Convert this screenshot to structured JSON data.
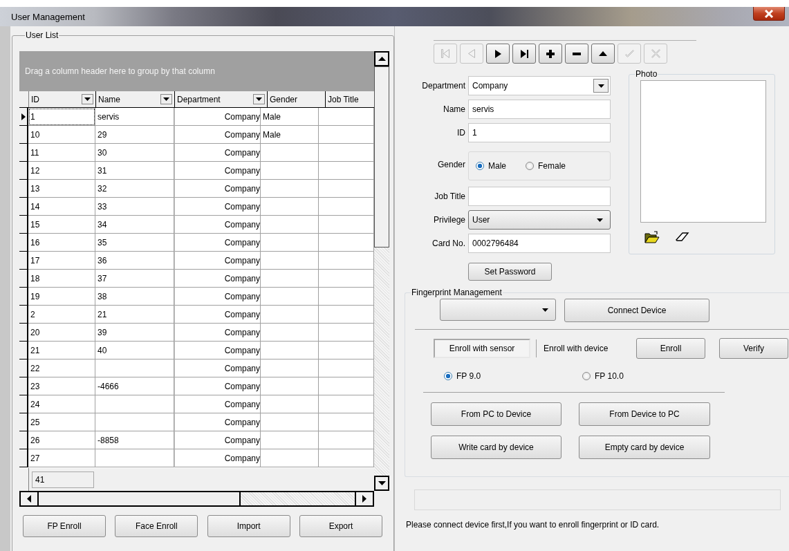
{
  "window": {
    "title": "User Management"
  },
  "user_list": {
    "title": "User List",
    "group_hint": "Drag a column header here to group by that column",
    "columns": [
      {
        "label": "ID",
        "filter": true
      },
      {
        "label": "Name",
        "filter": true
      },
      {
        "label": "Department",
        "filter": true
      },
      {
        "label": "Gender",
        "filter": false
      },
      {
        "label": "Job Title",
        "filter": false
      }
    ],
    "rows": [
      {
        "id": "1",
        "name": "servis",
        "department": "Company",
        "gender": "Male",
        "selected": true
      },
      {
        "id": "10",
        "name": "29",
        "department": "Company",
        "gender": "Male",
        "selected": false
      },
      {
        "id": "11",
        "name": "30",
        "department": "Company",
        "selected": false
      },
      {
        "id": "12",
        "name": "31",
        "department": "Company",
        "selected": false
      },
      {
        "id": "13",
        "name": "32",
        "department": "Company",
        "selected": false
      },
      {
        "id": "14",
        "name": "33",
        "department": "Company",
        "selected": false
      },
      {
        "id": "15",
        "name": "34",
        "department": "Company",
        "selected": false
      },
      {
        "id": "16",
        "name": "35",
        "department": "Company",
        "selected": false
      },
      {
        "id": "17",
        "name": "36",
        "department": "Company",
        "selected": false
      },
      {
        "id": "18",
        "name": "37",
        "department": "Company",
        "selected": false
      },
      {
        "id": "19",
        "name": "38",
        "department": "Company",
        "selected": false
      },
      {
        "id": "2",
        "name": "21",
        "department": "Company",
        "selected": false
      },
      {
        "id": "20",
        "name": "39",
        "department": "Company",
        "selected": false
      },
      {
        "id": "21",
        "name": "40",
        "department": "Company",
        "selected": false
      },
      {
        "id": "22",
        "department": "Company",
        "selected": false
      },
      {
        "id": "23",
        "name": "-4666",
        "department": "Company",
        "selected": false
      },
      {
        "id": "24",
        "department": "Company",
        "selected": false
      },
      {
        "id": "25",
        "department": "Company",
        "selected": false
      },
      {
        "id": "26",
        "name": "-8858",
        "department": "Company",
        "selected": false
      },
      {
        "id": "27",
        "department": "Company",
        "selected": false
      }
    ],
    "footer_count": "41"
  },
  "list_buttons": [
    "FP Enroll",
    "Face Enroll",
    "Import",
    "Export"
  ],
  "navigator": [
    {
      "kind": "first",
      "disabled": true
    },
    {
      "kind": "prev",
      "disabled": true
    },
    {
      "kind": "next",
      "disabled": false
    },
    {
      "kind": "last",
      "disabled": false
    },
    {
      "kind": "add",
      "disabled": false
    },
    {
      "kind": "delete",
      "disabled": false
    },
    {
      "kind": "up",
      "disabled": false
    },
    {
      "kind": "post",
      "disabled": true
    },
    {
      "kind": "cancel",
      "disabled": true
    }
  ],
  "form": {
    "department": {
      "label": "Department",
      "value": "Company"
    },
    "name": {
      "label": "Name",
      "value": "servis"
    },
    "id": {
      "label": "ID",
      "value": "1"
    },
    "gender": {
      "label": "Gender",
      "options": [
        {
          "label": "Male",
          "selected": true
        },
        {
          "label": "Female",
          "selected": false
        }
      ]
    },
    "job_title": {
      "label": "Job Title"
    },
    "privilege": {
      "label": "Privilege",
      "value": "User"
    },
    "card_no": {
      "label": "Card No.",
      "value": "0002796484"
    },
    "set_password": "Set Password"
  },
  "photo": {
    "title": "Photo"
  },
  "fingerprint": {
    "title": "Fingerprint Management",
    "connect": "Connect Device",
    "enroll_sensor": {
      "label": "Enroll with sensor",
      "selected": true
    },
    "enroll_device_label": "Enroll with device",
    "enroll": "Enroll",
    "verify": "Verify",
    "versions": [
      {
        "label": "FP 9.0",
        "selected": true
      },
      {
        "label": "FP 10.0",
        "selected": false
      }
    ],
    "actions": [
      "From PC to Device",
      "From Device to PC",
      "Write card by device",
      "Empty card by device"
    ]
  },
  "message": "Please connect device first,If you want to enroll fingerprint or ID card."
}
